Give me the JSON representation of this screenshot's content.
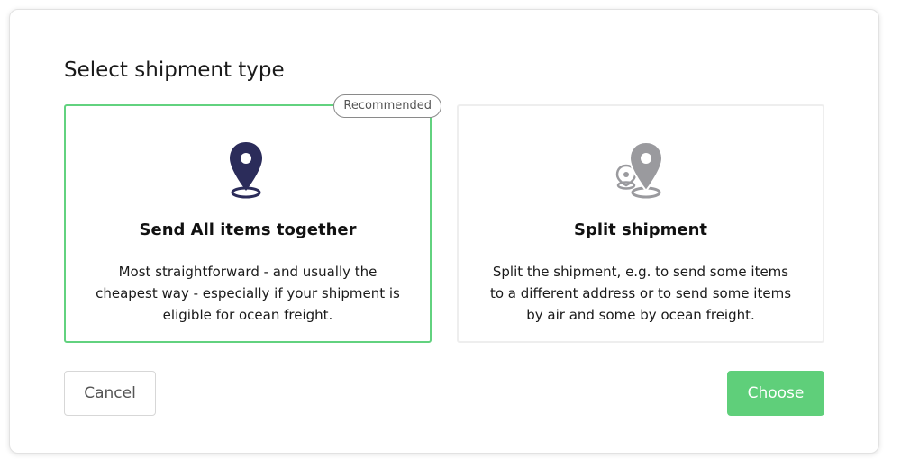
{
  "dialog": {
    "title": "Select shipment type"
  },
  "options": [
    {
      "id": "together",
      "badge": "Recommended",
      "title": "Send All items together",
      "description": "Most straightforward - and usually the cheapest way - especially if your shipment is eligible for ocean freight.",
      "icon": "map-pin-icon",
      "selected": true
    },
    {
      "id": "split",
      "title": "Split shipment",
      "description": "Split the shipment, e.g. to send some items to a different address or to send some items by air and some by ocean freight.",
      "icon": "multi-map-pin-icon",
      "selected": false
    }
  ],
  "actions": {
    "cancel_label": "Cancel",
    "choose_label": "Choose"
  },
  "colors": {
    "accent": "#5fcf7a",
    "selected_border": "#62d27f",
    "pin_dark": "#2b2c5a",
    "pin_gray": "#9a9a9e"
  }
}
